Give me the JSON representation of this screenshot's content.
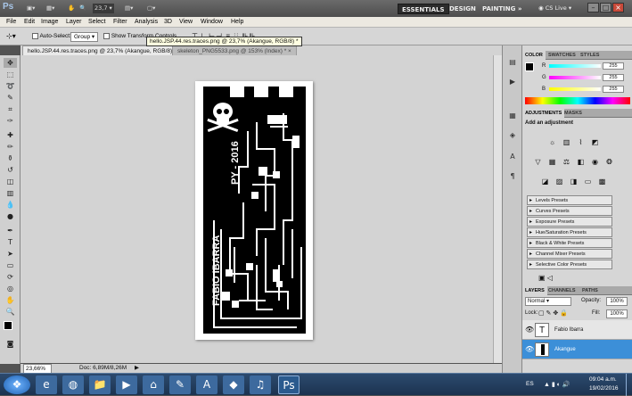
{
  "app": {
    "logo": "Ps",
    "zoom_control": "23,7",
    "workspaces": [
      "ESSENTIALS",
      "DESIGN",
      "PAINTING"
    ],
    "more_workspaces": "»",
    "cs_live": "CS Live",
    "window_buttons": [
      "–",
      "□",
      "×"
    ]
  },
  "menubar": [
    "File",
    "Edit",
    "Image",
    "Layer",
    "Select",
    "Filter",
    "Analysis",
    "3D",
    "View",
    "Window",
    "Help"
  ],
  "options_bar": {
    "auto_select_label": "Auto-Select:",
    "auto_select_value": "Group",
    "show_transform_label": "Show Transform Controls"
  },
  "tooltip": "hello.JSP.44.res.traces.png @ 23,7% (Akangue, RGB/8) *",
  "documents": {
    "tabs": [
      {
        "label": "hello.JSP.44.res.traces.png @ 23,7% (Akangue, RGB/8) *",
        "close": "×"
      },
      {
        "label": "skeleton_PNG5533.png @ 153% (Index) *",
        "close": "×"
      }
    ]
  },
  "artwork": {
    "name_text": "FABIO IBARRA",
    "sub_text": "PY - 2016"
  },
  "status": {
    "zoom": "23,66%",
    "doc_info": "Doc: 6,89M/8,26M",
    "arrow": "▶"
  },
  "color_panel": {
    "tabs": [
      "COLOR",
      "SWATCHES",
      "STYLES"
    ],
    "channels": [
      {
        "label": "R",
        "value": "255",
        "gradient": "#ff0000"
      },
      {
        "label": "G",
        "value": "255",
        "gradient": "#00ff00"
      },
      {
        "label": "B",
        "value": "255",
        "gradient": "#0000ff"
      }
    ]
  },
  "adjustments_panel": {
    "tabs": [
      "ADJUSTMENTS",
      "MASKS"
    ],
    "heading": "Add an adjustment",
    "presets": [
      "Levels Presets",
      "Curves Presets",
      "Exposure Presets",
      "Hue/Saturation Presets",
      "Black & White Presets",
      "Channel Mixer Presets",
      "Selective Color Presets"
    ]
  },
  "layers_panel": {
    "tabs": [
      "LAYERS",
      "CHANNELS",
      "PATHS"
    ],
    "blend_mode": "Normal",
    "opacity_label": "Opacity:",
    "opacity_value": "100%",
    "lock_label": "Lock:",
    "fill_label": "Fill:",
    "fill_value": "100%",
    "layers": [
      {
        "name": "Fabio Ibarra",
        "thumb": "T",
        "selected": false
      },
      {
        "name": "Akangue",
        "thumb": "",
        "selected": true
      }
    ]
  },
  "taskbar": {
    "language": "ES",
    "time": "09:04 a.m.",
    "date": "19/02/2016"
  },
  "colors": {
    "selected_layer": "#3c8fd8",
    "accent_blue": "#1e72c8"
  }
}
